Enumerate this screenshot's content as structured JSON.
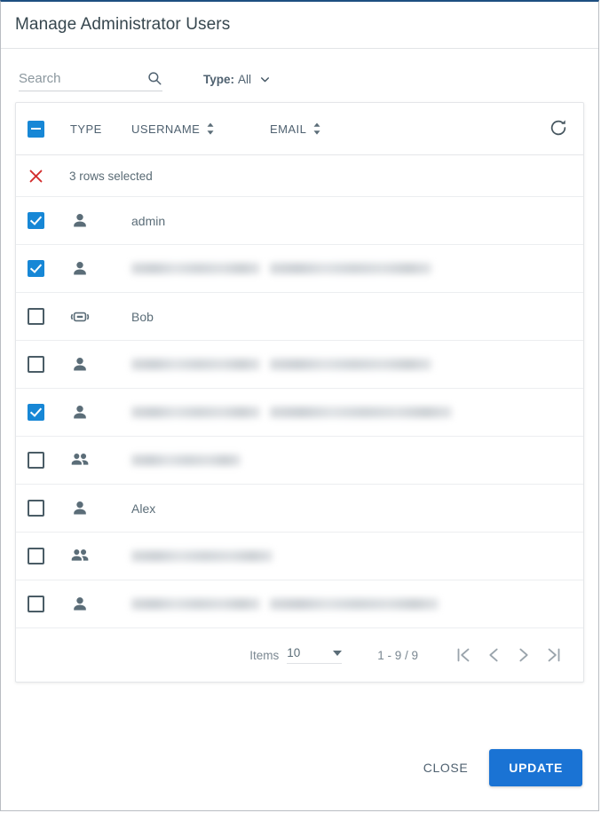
{
  "dialog": {
    "title": "Manage Administrator Users",
    "accent_color": "#1a73d4",
    "checkbox_color": "#1787d6",
    "danger_color": "#d32f2f"
  },
  "toolbar": {
    "search": {
      "value": "",
      "placeholder": "Search",
      "icon": "search-icon"
    },
    "type_filter": {
      "label": "Type:",
      "value": "All",
      "icon": "chevron-down-icon"
    }
  },
  "table": {
    "select_all_state": "indeterminate",
    "refresh_icon": "refresh-icon",
    "columns": [
      {
        "key": "type",
        "label": "TYPE",
        "sortable": false
      },
      {
        "key": "username",
        "label": "USERNAME",
        "sortable": true
      },
      {
        "key": "email",
        "label": "EMAIL",
        "sortable": true
      }
    ],
    "selection_banner": {
      "text": "3 rows selected",
      "icon": "close-x-icon"
    },
    "rows": [
      {
        "checked": true,
        "type_icon": "user-icon",
        "username": "admin",
        "username_redacted": false,
        "email": "",
        "email_redacted": false,
        "username_bar_w": 0,
        "email_bar_w": 0
      },
      {
        "checked": true,
        "type_icon": "user-icon",
        "username": "",
        "username_redacted": true,
        "email": "",
        "email_redacted": true,
        "username_bar_w": 145,
        "email_bar_w": 182
      },
      {
        "checked": false,
        "type_icon": "device-icon",
        "username": "Bob",
        "username_redacted": false,
        "email": "",
        "email_redacted": false,
        "username_bar_w": 0,
        "email_bar_w": 0
      },
      {
        "checked": false,
        "type_icon": "user-icon",
        "username": "",
        "username_redacted": true,
        "email": "",
        "email_redacted": true,
        "username_bar_w": 145,
        "email_bar_w": 182
      },
      {
        "checked": true,
        "type_icon": "user-icon",
        "username": "",
        "username_redacted": true,
        "email": "",
        "email_redacted": true,
        "username_bar_w": 145,
        "email_bar_w": 205
      },
      {
        "checked": false,
        "type_icon": "group-icon",
        "username": "",
        "username_redacted": true,
        "email": "",
        "email_redacted": false,
        "username_bar_w": 123,
        "email_bar_w": 0
      },
      {
        "checked": false,
        "type_icon": "user-icon",
        "username": "Alex",
        "username_redacted": false,
        "email": "",
        "email_redacted": false,
        "username_bar_w": 0,
        "email_bar_w": 0
      },
      {
        "checked": false,
        "type_icon": "group-icon",
        "username": "",
        "username_redacted": true,
        "email": "",
        "email_redacted": false,
        "username_bar_w": 159,
        "email_bar_w": 0
      },
      {
        "checked": false,
        "type_icon": "user-icon",
        "username": "",
        "username_redacted": true,
        "email": "",
        "email_redacted": true,
        "username_bar_w": 145,
        "email_bar_w": 190
      }
    ]
  },
  "pagination": {
    "items_label": "Items",
    "items_per_page": "10",
    "range_text": "1 - 9 / 9",
    "first_icon": "first-page-icon",
    "prev_icon": "prev-page-icon",
    "next_icon": "next-page-icon",
    "last_icon": "last-page-icon"
  },
  "footer": {
    "close_label": "CLOSE",
    "update_label": "UPDATE"
  }
}
